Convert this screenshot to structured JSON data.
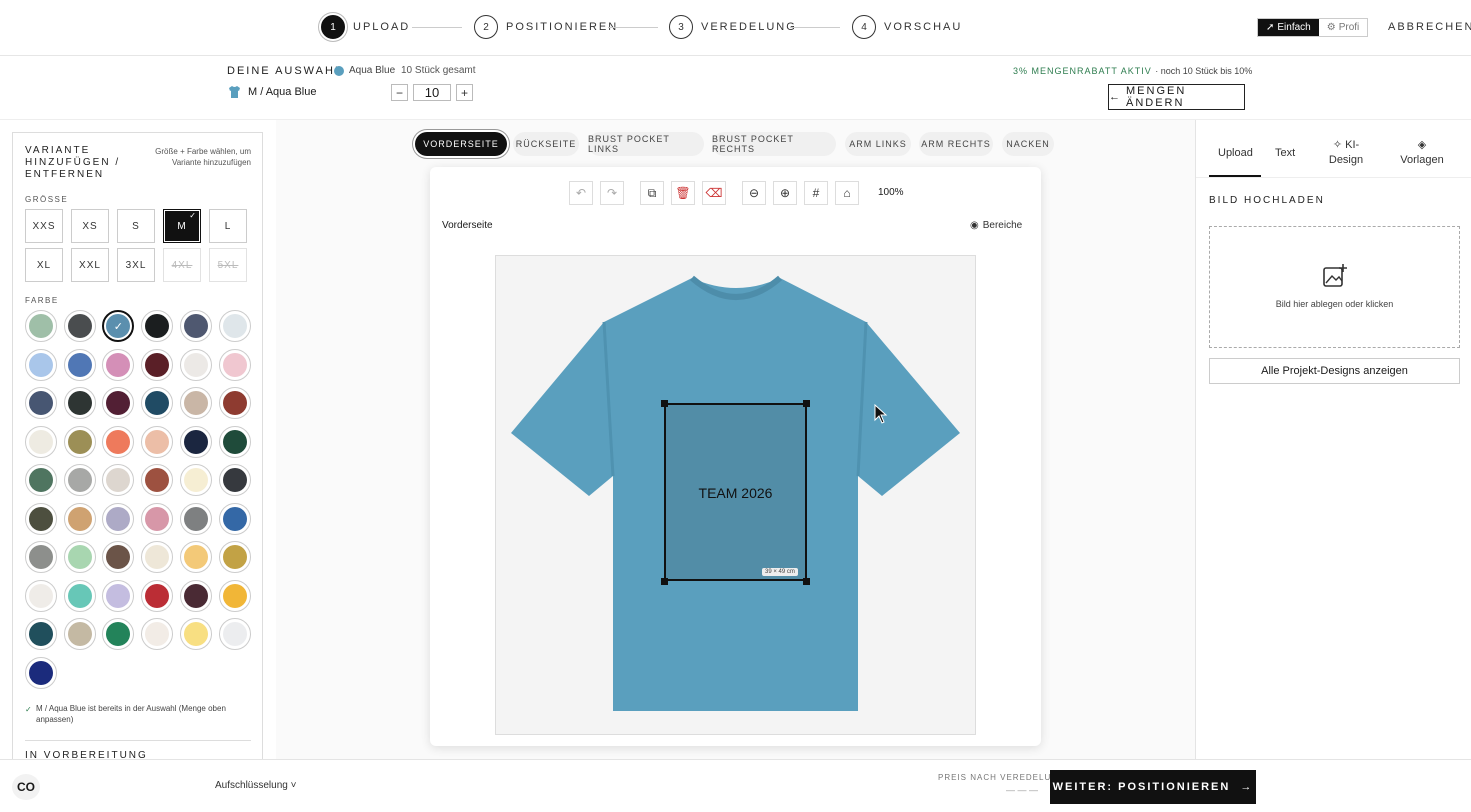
{
  "steps": [
    {
      "num": "1",
      "label": "UPLOAD"
    },
    {
      "num": "2",
      "label": "POSITIONIEREN"
    },
    {
      "num": "3",
      "label": "VEREDELUNG"
    },
    {
      "num": "4",
      "label": "VORSCHAU"
    }
  ],
  "mode": {
    "simple": "Einfach",
    "pro": "Profi"
  },
  "cancel": "ABBRECHEN",
  "selection": {
    "label": "DEINE AUSWAHL",
    "color_name": "Aqua Blue",
    "total": "10 Stück gesamt",
    "variant": "M / Aqua Blue",
    "qty": "10",
    "discount": "3% MENGENRABATT AKTIV",
    "discount_note": "· noch 10 Stück bis 10%",
    "change_btn": "MENGEN ÄNDERN"
  },
  "variant_panel": {
    "title": "VARIANTE HINZUFÜGEN / ENTFERNEN",
    "hint": "Größe + Farbe wählen, um Variante hinzuzufügen",
    "size_label": "GRÖSSE",
    "color_label": "FARBE",
    "notice": "M / Aqua Blue ist bereits in der Auswahl (Menge oben anpassen)",
    "prep": "IN VORBEREITUNG",
    "sizes": [
      {
        "label": "XXS",
        "state": "normal"
      },
      {
        "label": "XS",
        "state": "normal"
      },
      {
        "label": "S",
        "state": "normal"
      },
      {
        "label": "M",
        "state": "selected"
      },
      {
        "label": "L",
        "state": "normal"
      },
      {
        "label": "XL",
        "state": "normal"
      },
      {
        "label": "XXL",
        "state": "normal"
      },
      {
        "label": "3XL",
        "state": "normal"
      },
      {
        "label": "4XL",
        "state": "disabled"
      },
      {
        "label": "5XL",
        "state": "disabled"
      }
    ],
    "colors": [
      "#9fbfa8",
      "#4a4d4f",
      "#5b8fae",
      "#1b1e1f",
      "#4f5870",
      "#dfe6ea",
      "#a9c6ea",
      "#5077b5",
      "#d48fb7",
      "#5a1f27",
      "#ece9e6",
      "#f0c7d0",
      "#475672",
      "#2e3533",
      "#521f34",
      "#204b64",
      "#c9b6a6",
      "#8e3b30",
      "#eeebe2",
      "#9c8f56",
      "#ee7a5c",
      "#ecbea7",
      "#1b2640",
      "#1f4b3a",
      "#4f7560",
      "#a7a8a6",
      "#ddd6cf",
      "#9d5140",
      "#f6eed3",
      "#36393e",
      "#4d4f3f",
      "#cfa271",
      "#adaac6",
      "#d797a8",
      "#7e8081",
      "#3468a6",
      "#8d8f8c",
      "#a8d6b0",
      "#6b5448",
      "#eee7d8",
      "#f3c978",
      "#c2a245",
      "#efece8",
      "#67c7b7",
      "#c4bde0",
      "#bb2d35",
      "#4a2a34",
      "#f1b637",
      "#204f5c",
      "#c4b9a3",
      "#23835a",
      "#f2ece6",
      "#f8df82",
      "#ecedef",
      "#1b2b7c"
    ],
    "selected_color": 2
  },
  "view_tabs": [
    "VORDERSEITE",
    "RÜCKSEITE",
    "BRUST POCKET LINKS",
    "BRUST POCKET RECHTS",
    "ARM LINKS",
    "ARM RECHTS",
    "NACKEN"
  ],
  "canvas": {
    "side": "Vorderseite",
    "areas": "Bereiche",
    "zoom": "100%",
    "design_text": "TEAM 2026",
    "size_badge": "39 × 49 cm"
  },
  "right": {
    "tabs": [
      "Upload",
      "Text",
      "KI-Design",
      "Vorlagen"
    ],
    "upload_title": "BILD HOCHLADEN",
    "drop_text": "Bild hier ablegen oder klicken",
    "all_designs": "Alle Projekt-Designs anzeigen"
  },
  "bottom": {
    "breakdown": "Aufschlüsselung",
    "price_label": "PREIS NACH VEREDELUNG",
    "price_value": "— — —",
    "next_btn": "WEITER: POSITIONIEREN"
  },
  "colors": {
    "accent": "#111111",
    "discount": "#2e7d4f",
    "shirt": "#5a9fbe"
  }
}
